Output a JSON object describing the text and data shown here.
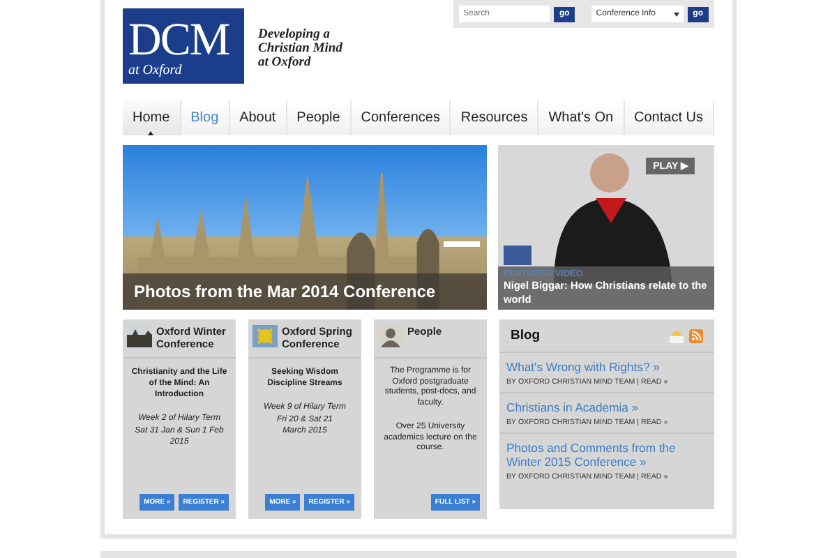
{
  "header": {
    "logo_main": "DCM",
    "logo_sub": "at Oxford",
    "tagline": [
      "Developing a",
      "Christian Mind",
      "at Oxford"
    ],
    "search": {
      "placeholder": "Search",
      "button": "go"
    },
    "dropdown": {
      "value": "Conference Info",
      "button": "go"
    }
  },
  "nav": [
    {
      "label": "Home",
      "selected": true,
      "highlighted": false
    },
    {
      "label": "Blog",
      "selected": false,
      "highlighted": true
    },
    {
      "label": "About",
      "selected": false,
      "highlighted": false
    },
    {
      "label": "People",
      "selected": false,
      "highlighted": false
    },
    {
      "label": "Conferences",
      "selected": false,
      "highlighted": false
    },
    {
      "label": "Resources",
      "selected": false,
      "highlighted": false
    },
    {
      "label": "What's On",
      "selected": false,
      "highlighted": false
    },
    {
      "label": "Contact Us",
      "selected": false,
      "highlighted": false
    }
  ],
  "slider": {
    "caption": "Photos from the Mar 2014 Conference"
  },
  "video": {
    "play": "PLAY ▶",
    "kicker": "FEATURED VIDEO",
    "title": "Nigel Biggar: How Christians relate to the world"
  },
  "cards": [
    {
      "kind": "winter",
      "title": "Oxford Winter Conference",
      "heading": "Christianity and the Life of the Mind: An Introduction",
      "details": [
        "Week 2 of Hilary Term",
        "Sat 31 Jan & Sun 1 Feb 2015"
      ],
      "buttons": [
        "MORE »",
        "REGISTER »"
      ]
    },
    {
      "kind": "spring",
      "title": "Oxford Spring Conference",
      "heading": "Seeking Wisdom Discipline Streams",
      "details": [
        "Week 9 of Hilary Term",
        "Fri 20 & Sat 21",
        "March 2015"
      ],
      "buttons": [
        "MORE »",
        "REGISTER »"
      ]
    },
    {
      "kind": "people",
      "title": "People",
      "paragraphs": [
        "The Programme is for Oxford postgraduate students, post-docs, and faculty.",
        "Over 25 University academics lecture on the course."
      ],
      "buttons": [
        "FULL LIST »"
      ]
    }
  ],
  "blog": {
    "title": "Blog",
    "posts": [
      {
        "title": "What's Wrong with Rights? »",
        "byline": "BY OXFORD CHRISTIAN MIND TEAM | READ »"
      },
      {
        "title": "Christians in Academia »",
        "byline": "BY OXFORD CHRISTIAN MIND TEAM | READ »"
      },
      {
        "title": "Photos and Comments from the Winter 2015 Conference »",
        "byline": "BY OXFORD CHRISTIAN MIND TEAM | READ »"
      }
    ]
  }
}
